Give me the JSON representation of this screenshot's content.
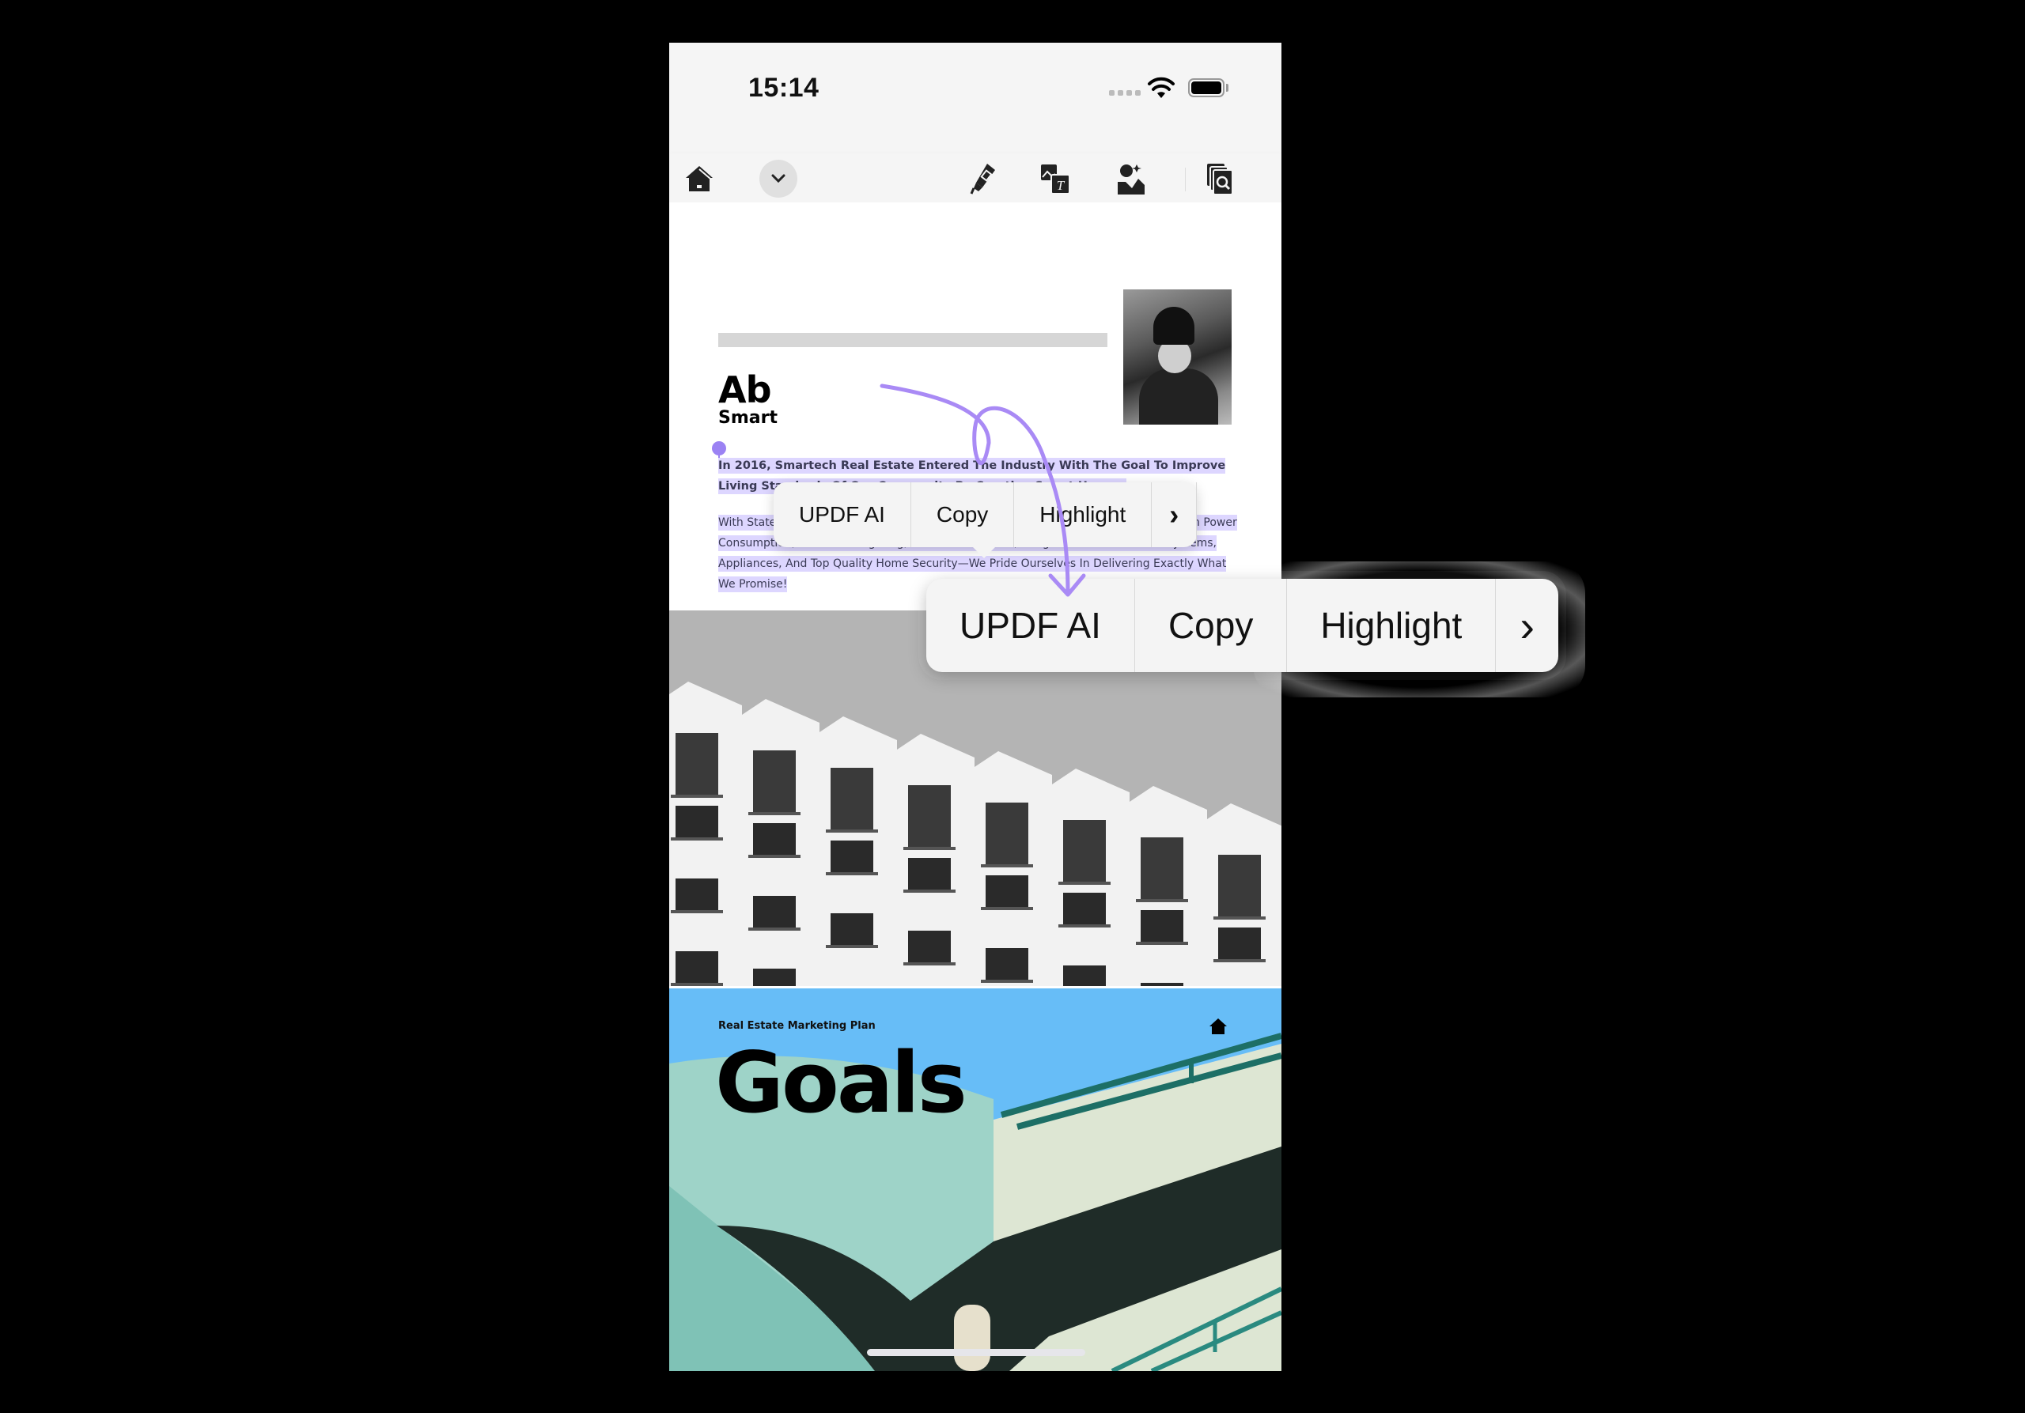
{
  "status_bar": {
    "time": "15:14"
  },
  "toolbar": {
    "icons": [
      "home-icon",
      "chevron-down-icon",
      "highlighter-icon",
      "image-text-icon",
      "ai-person-icon",
      "pages-search-icon"
    ]
  },
  "document": {
    "heading_partial": "Ab",
    "subheading_partial": "Smart",
    "paragraph1": "In 2016, Smartech Real Estate Entered The Industry With The Goal To Improve Living Standards Of Our Community By Creating Smart Homes.",
    "paragraph2": "With State-Of-The-Art Technology, Like Built-In Heating And Cooling Systems, Minimum Power Consumption, Controlled Lighting, Controlled Climate, Integrated Entertainment Systems, Appliances, And Top Quality Home Security—We Pride Ourselves In Delivering Exactly What We Promise!",
    "goals_page": {
      "label": "Real Estate Marketing Plan",
      "title": "Goals"
    }
  },
  "context_menu": {
    "items": [
      {
        "label": "UPDF AI"
      },
      {
        "label": "Copy"
      },
      {
        "label": "Highlight"
      }
    ],
    "more_glyph": "›"
  },
  "colors": {
    "selection": "#ddd6ff",
    "handle": "#9b82f3",
    "annotation_arrow": "#a98af5",
    "goals_sky": "#67bdf7"
  }
}
